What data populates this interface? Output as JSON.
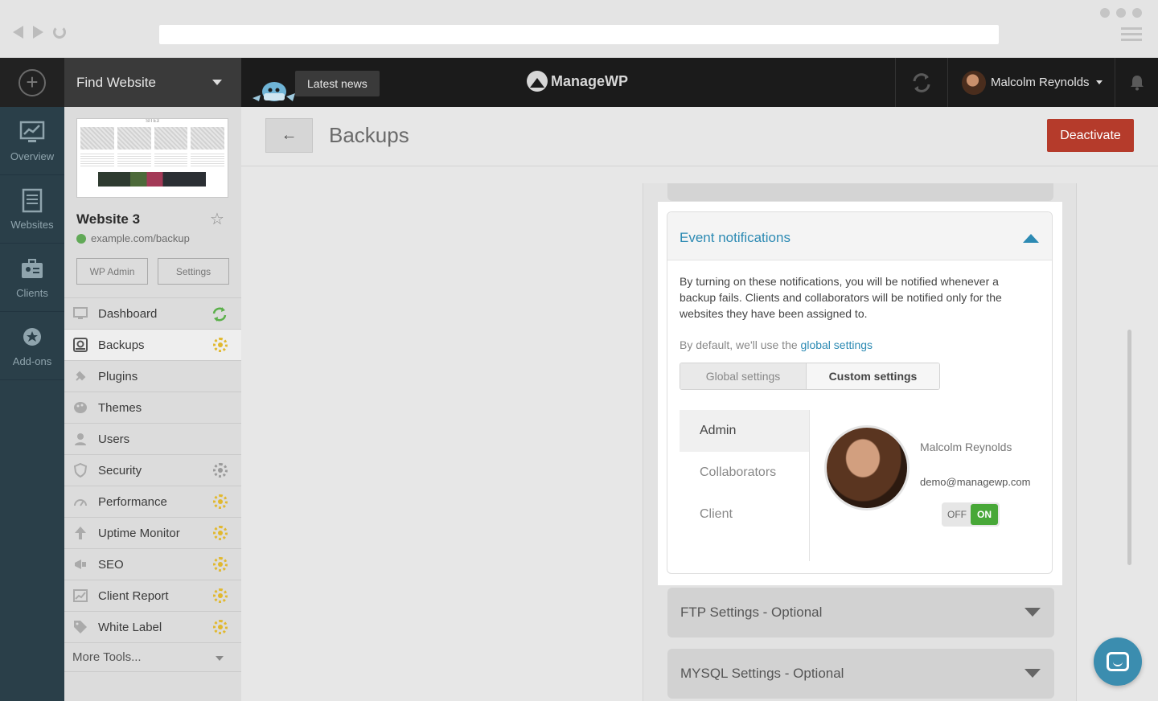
{
  "browser": {
    "back": "back",
    "forward": "forward",
    "reload": "reload"
  },
  "topbar": {
    "find_website": "Find Website",
    "latest_news": "Latest news",
    "logo_text": "ManageWP",
    "user_name": "Malcolm Reynolds"
  },
  "rail": {
    "items": [
      {
        "label": "Overview",
        "icon": "overview-icon"
      },
      {
        "label": "Websites",
        "icon": "websites-icon"
      },
      {
        "label": "Clients",
        "icon": "clients-icon"
      },
      {
        "label": "Add-ons",
        "icon": "addons-icon"
      }
    ]
  },
  "site": {
    "thumb_header": "SITE3",
    "name": "Website 3",
    "url": "example.com/backup",
    "wp_admin": "WP Admin",
    "settings": "Settings",
    "menu": [
      {
        "label": "Dashboard",
        "badge": "sync"
      },
      {
        "label": "Backups",
        "badge": "gear-gold"
      },
      {
        "label": "Plugins",
        "badge": ""
      },
      {
        "label": "Themes",
        "badge": ""
      },
      {
        "label": "Users",
        "badge": ""
      },
      {
        "label": "Security",
        "badge": "gear-grey"
      },
      {
        "label": "Performance",
        "badge": "gear-gold"
      },
      {
        "label": "Uptime Monitor",
        "badge": "gear-gold"
      },
      {
        "label": "SEO",
        "badge": "gear-gold"
      },
      {
        "label": "Client Report",
        "badge": "gear-gold"
      },
      {
        "label": "White Label",
        "badge": "gear-gold"
      }
    ],
    "more_tools": "More Tools..."
  },
  "page": {
    "title": "Backups",
    "deactivate": "Deactivate"
  },
  "event_notifications": {
    "title": "Event notifications",
    "description": "By turning on these notifications, you will be notified whenever a backup fails. Clients and collaborators will be notified only for the websites they have been assigned to.",
    "default_prefix": "By default, we'll use the ",
    "default_link": "global settings",
    "tabs": {
      "global": "Global settings",
      "custom": "Custom settings",
      "selected": "custom"
    },
    "roles": [
      "Admin",
      "Collaborators",
      "Client"
    ],
    "selected_role": "Admin",
    "member": {
      "name": "Malcolm Reynolds",
      "email": "demo@managewp.com"
    },
    "toggle": {
      "off": "OFF",
      "on": "ON",
      "state": "on"
    }
  },
  "accordions": {
    "ftp": "FTP Settings - Optional",
    "mysql": "MYSQL Settings - Optional"
  },
  "colors": {
    "accent": "#2c8ab3",
    "danger": "#b53b2b",
    "success": "#48a838",
    "gold": "#e1b82e"
  }
}
